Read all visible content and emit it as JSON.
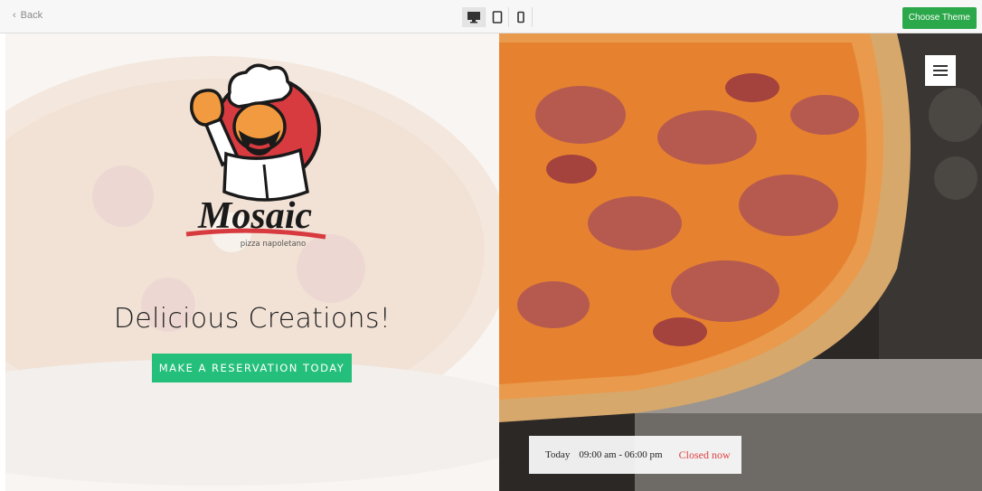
{
  "toolbar": {
    "back_label": "Back",
    "choose_theme_label": "Choose Theme",
    "devices": [
      "desktop-icon",
      "tablet-icon",
      "mobile-icon"
    ],
    "active_device": "desktop"
  },
  "site": {
    "brand_name": "Mosaic",
    "brand_tagline": "pizza napoletano",
    "headline": "Delicious Creations!",
    "cta_label": "MAKE A RESERVATION TODAY",
    "hours": {
      "day": "Today",
      "time": "09:00 am - 06:00 pm",
      "status": "Closed now"
    }
  },
  "colors": {
    "choose_theme_bg": "#2ba84a",
    "cta_bg": "#24c07b",
    "closed_status": "#e2403f",
    "logo_red": "#d83b3f"
  }
}
